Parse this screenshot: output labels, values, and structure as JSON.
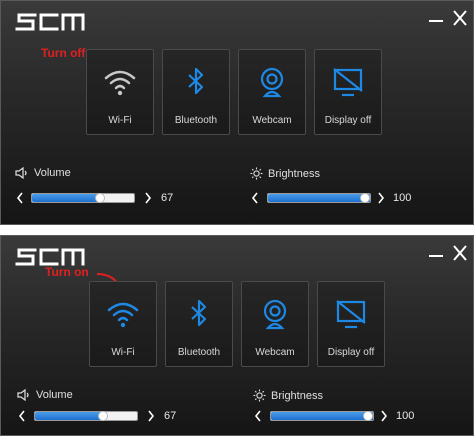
{
  "panels": [
    {
      "annotation": "Turn off",
      "tiles": [
        {
          "label": "Wi-Fi",
          "icon": "wifi-icon",
          "active": false
        },
        {
          "label": "Bluetooth",
          "icon": "bluetooth-icon",
          "active": true
        },
        {
          "label": "Webcam",
          "icon": "webcam-icon",
          "active": true
        },
        {
          "label": "Display off",
          "icon": "display-off-icon",
          "active": true
        }
      ],
      "volume": {
        "label": "Volume",
        "value": "67",
        "level": 0.67
      },
      "brightness": {
        "label": "Brightness",
        "value": "100",
        "level": 1.0
      }
    },
    {
      "annotation": "Turn on",
      "tiles": [
        {
          "label": "Wi-Fi",
          "icon": "wifi-icon",
          "active": true
        },
        {
          "label": "Bluetooth",
          "icon": "bluetooth-icon",
          "active": true
        },
        {
          "label": "Webcam",
          "icon": "webcam-icon",
          "active": true
        },
        {
          "label": "Display off",
          "icon": "display-off-icon",
          "active": true
        }
      ],
      "volume": {
        "label": "Volume",
        "value": "67",
        "level": 0.67
      },
      "brightness": {
        "label": "Brightness",
        "value": "100",
        "level": 1.0
      }
    }
  ],
  "colors": {
    "accent": "#1e88e5",
    "inactive_icon": "#c8c8c8",
    "annotation": "#e02020"
  }
}
